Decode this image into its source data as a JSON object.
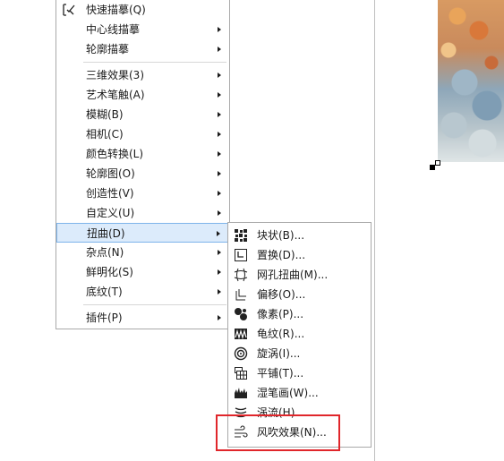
{
  "menu1": {
    "items": [
      {
        "label": "快速描摹(Q)",
        "submenu": false
      },
      {
        "label": "中心线描摹",
        "submenu": true
      },
      {
        "label": "轮廓描摹",
        "submenu": true
      },
      {
        "label": "三维效果(3)",
        "submenu": true
      },
      {
        "label": "艺术笔触(A)",
        "submenu": true
      },
      {
        "label": "模糊(B)",
        "submenu": true
      },
      {
        "label": "相机(C)",
        "submenu": true
      },
      {
        "label": "颜色转换(L)",
        "submenu": true
      },
      {
        "label": "轮廓图(O)",
        "submenu": true
      },
      {
        "label": "创造性(V)",
        "submenu": true
      },
      {
        "label": "自定义(U)",
        "submenu": true
      },
      {
        "label": "扭曲(D)",
        "submenu": true,
        "selected": true
      },
      {
        "label": "杂点(N)",
        "submenu": true
      },
      {
        "label": "鲜明化(S)",
        "submenu": true
      },
      {
        "label": "底纹(T)",
        "submenu": true
      },
      {
        "label": "插件(P)",
        "submenu": true
      }
    ]
  },
  "menu2": {
    "items": [
      {
        "label": "块状(B)...",
        "icon": "blocks-icon"
      },
      {
        "label": "置换(D)...",
        "icon": "displace-icon"
      },
      {
        "label": "网孔扭曲(M)...",
        "icon": "mesh-warp-icon"
      },
      {
        "label": "偏移(O)...",
        "icon": "offset-icon"
      },
      {
        "label": "像素(P)...",
        "icon": "pixelate-icon"
      },
      {
        "label": "龟纹(R)...",
        "icon": "ripple-icon"
      },
      {
        "label": "旋涡(I)...",
        "icon": "swirl-icon"
      },
      {
        "label": "平铺(T)...",
        "icon": "tile-icon"
      },
      {
        "label": "湿笔画(W)...",
        "icon": "wet-paint-icon"
      },
      {
        "label": "涡流(H)...",
        "icon": "whirlpool-icon"
      },
      {
        "label": "风吹效果(N)...",
        "icon": "wind-icon"
      }
    ]
  },
  "colors": {
    "selection_bg": "#dcebfb",
    "selection_border": "#7eb4ea",
    "highlight_box": "#e0262b"
  }
}
